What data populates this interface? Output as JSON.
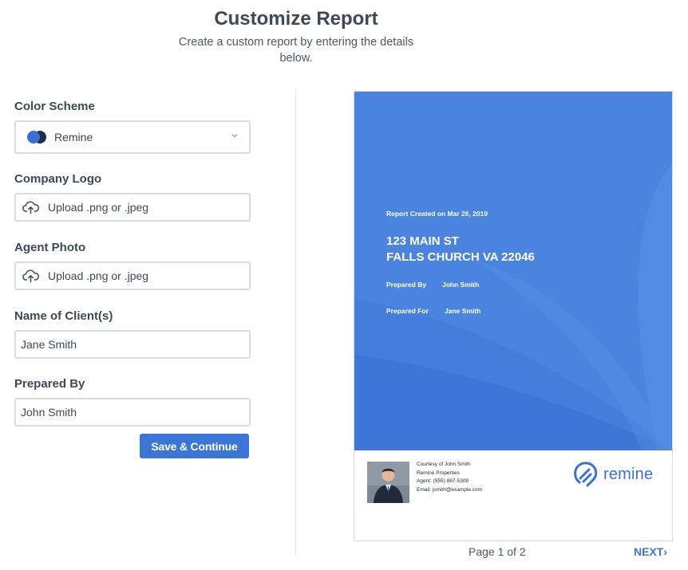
{
  "header": {
    "title": "Customize Report",
    "subtitle": "Create a custom report by entering the details below."
  },
  "form": {
    "color_scheme": {
      "label": "Color Scheme",
      "value": "Remine"
    },
    "company_logo": {
      "label": "Company Logo",
      "upload_text": "Upload .png or .jpeg"
    },
    "agent_photo": {
      "label": "Agent Photo",
      "upload_text": "Upload .png or .jpeg"
    },
    "client_name": {
      "label": "Name of Client(s)",
      "value": "Jane Smith"
    },
    "prepared_by": {
      "label": "Prepared By",
      "value": "John Smith"
    },
    "save_label": "Save & Continue"
  },
  "report": {
    "created": "Report Created on Mar 26, 2019",
    "address_line1": "123 MAIN ST",
    "address_line2": "FALLS CHURCH VA 22046",
    "prepared_by_label": "Prepared By",
    "prepared_by_value": "John Smith",
    "prepared_for_label": "Prepared For",
    "prepared_for_value": "Jane Smith",
    "agent": {
      "courtesy": "Courtesy of John Smith",
      "company": "Remine Properties",
      "phone": "Agent: (555) 867-5309",
      "email": "Email: jsmith@example.com"
    },
    "logo_text": "remine"
  },
  "pagination": {
    "page_indicator": "Page 1 of 2",
    "next_label": "NEXT"
  },
  "colors": {
    "accent": "#3b76d6",
    "cover": "#4a84e0",
    "scheme_dark": "#1f2f4a",
    "scheme_light": "#3b6fd1"
  },
  "icons": {
    "upload": "cloud-upload-icon",
    "dropdown": "chevron-down-icon",
    "next": "chevron-right-icon",
    "logo": "remine-logo-icon"
  }
}
